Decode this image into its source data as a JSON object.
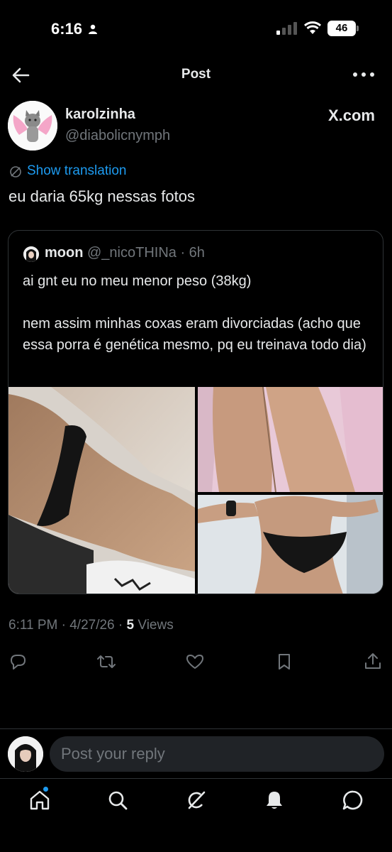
{
  "status_bar": {
    "time": "6:16",
    "battery": "46"
  },
  "header": {
    "title": "Post"
  },
  "post": {
    "author_name": "karolzinha",
    "author_handle": "@diabolicnymph",
    "source_label": "X.com",
    "translate_label": "Show translation",
    "text": "eu daria 65kg nessas fotos",
    "timestamp": "6:11 PM · 4/27/26 · ",
    "views_count": "5",
    "views_label": " Views"
  },
  "quoted_post": {
    "author_name": "moon",
    "author_handle": " @_nicoTHINa · 6h",
    "text": "ai gnt eu no meu menor peso (38kg)\n\nnem assim minhas coxas eram divorciadas (acho que essa porra é genética mesmo, pq eu treinava todo dia)",
    "photo_count": 3
  },
  "reply": {
    "placeholder": "Post your reply"
  },
  "icons": {
    "back": "arrow-left-icon",
    "more": "more-dots-icon",
    "translate": "translate-icon",
    "actions": [
      "reply-icon",
      "repost-icon",
      "like-icon",
      "bookmark-icon",
      "share-icon"
    ],
    "tabs": [
      "home-icon",
      "search-icon",
      "grok-icon",
      "notifications-icon",
      "messages-icon"
    ]
  },
  "colors": {
    "background": "#000000",
    "text": "#e7e9ea",
    "secondary": "#71767b",
    "accent": "#1d9bf0",
    "border": "#2f3336"
  }
}
